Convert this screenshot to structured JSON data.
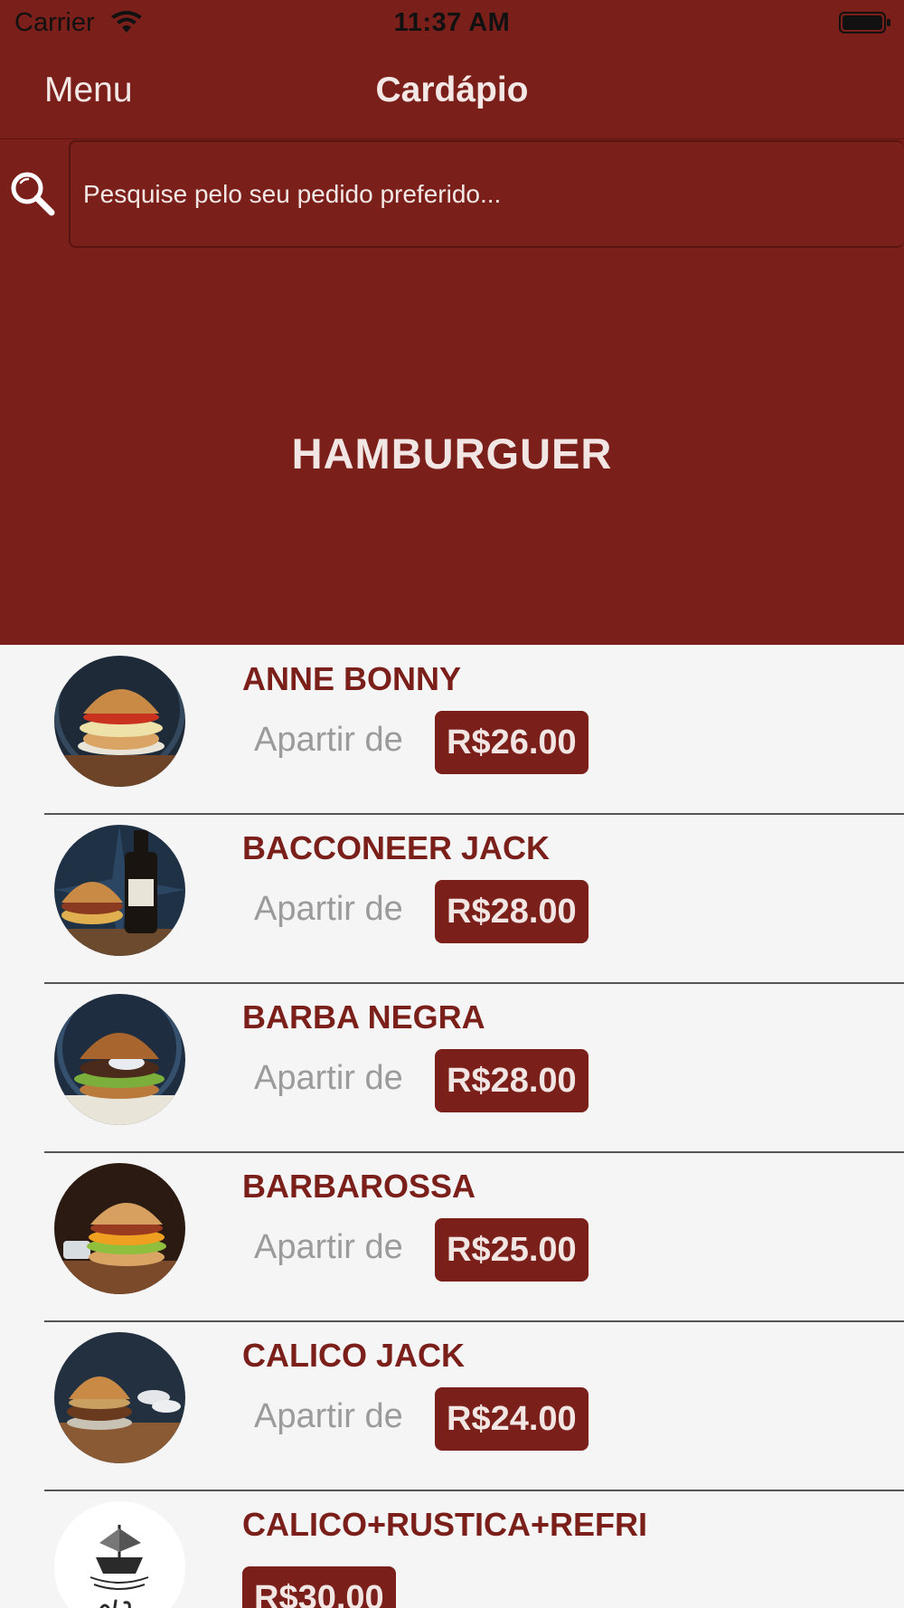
{
  "status_bar": {
    "carrier": "Carrier",
    "time": "11:37 AM"
  },
  "nav": {
    "menu_label": "Menu",
    "title": "Cardápio"
  },
  "search": {
    "placeholder": "Pesquise pelo seu pedido preferido..."
  },
  "category": {
    "title": "HAMBURGUER"
  },
  "colors": {
    "brand": "#7b1f1a",
    "background": "#f5f5f6",
    "muted_text": "#9b9b9b"
  },
  "items": [
    {
      "name": "ANNE BONNY",
      "from_label": "Apartir de",
      "price": "R$26.00",
      "image": "burger-photo"
    },
    {
      "name": "BACCONEER JACK",
      "from_label": "Apartir de",
      "price": "R$28.00",
      "image": "burger-and-whiskey-photo"
    },
    {
      "name": "BARBA NEGRA",
      "from_label": "Apartir de",
      "price": "R$28.00",
      "image": "burger-photo"
    },
    {
      "name": "BARBAROSSA",
      "from_label": "Apartir de",
      "price": "R$25.00",
      "image": "burger-photo"
    },
    {
      "name": "CALICO JACK",
      "from_label": "Apartir de",
      "price": "R$24.00",
      "image": "burger-photo"
    },
    {
      "name": "CALICO+RUSTICA+REFRI",
      "price": "R$30.00",
      "image": "the-ship-logo"
    }
  ]
}
